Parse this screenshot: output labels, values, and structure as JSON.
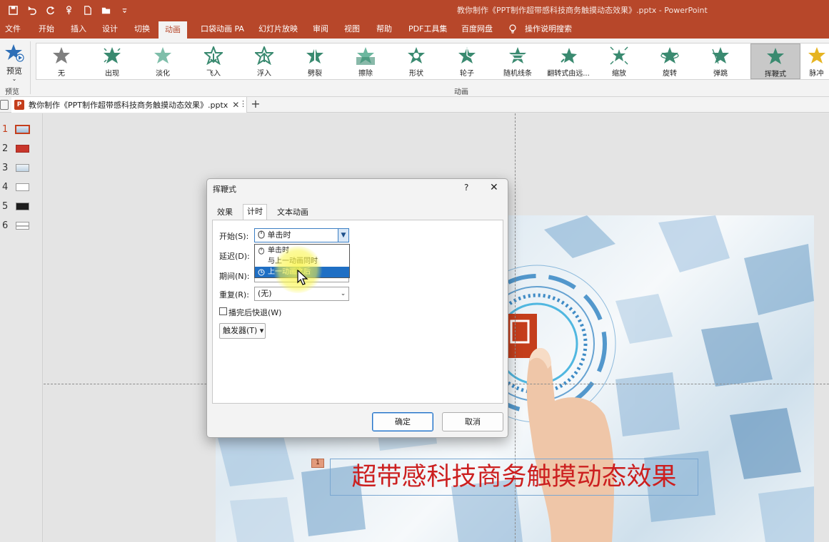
{
  "app": {
    "doc_title": "教你制作《PPT制作超带感科技商务触摸动态效果》.pptx  -  PowerPoint"
  },
  "menu": {
    "items": [
      {
        "label": "文件"
      },
      {
        "label": "开始"
      },
      {
        "label": "插入"
      },
      {
        "label": "设计"
      },
      {
        "label": "切换"
      },
      {
        "label": "动画",
        "active": true
      },
      {
        "label": "口袋动画 PA"
      },
      {
        "label": "幻灯片放映"
      },
      {
        "label": "审阅"
      },
      {
        "label": "视图"
      },
      {
        "label": "帮助"
      },
      {
        "label": "PDF工具集"
      },
      {
        "label": "百度网盘"
      },
      {
        "label": "操作说明搜索"
      }
    ]
  },
  "ribbon": {
    "preview_label": "预览",
    "preview_group_label": "预览",
    "animation_group_label": "动画",
    "animations": [
      {
        "label": "无",
        "icon": "star-gray-icon"
      },
      {
        "label": "出现",
        "icon": "star-green-icon"
      },
      {
        "label": "淡化",
        "icon": "star-green-icon"
      },
      {
        "label": "飞入",
        "icon": "star-green-icon"
      },
      {
        "label": "浮入",
        "icon": "star-green-icon"
      },
      {
        "label": "劈裂",
        "icon": "star-green-icon"
      },
      {
        "label": "擦除",
        "icon": "star-green-icon"
      },
      {
        "label": "形状",
        "icon": "star-green-icon"
      },
      {
        "label": "轮子",
        "icon": "star-green-icon"
      },
      {
        "label": "随机线条",
        "icon": "star-green-icon"
      },
      {
        "label": "翻转式由远...",
        "icon": "star-green-icon"
      },
      {
        "label": "缩放",
        "icon": "star-green-icon"
      },
      {
        "label": "旋转",
        "icon": "star-green-icon"
      },
      {
        "label": "弹跳",
        "icon": "star-green-icon"
      },
      {
        "label": "挥鞭式",
        "icon": "star-green-icon",
        "selected": true
      },
      {
        "label": "脉冲",
        "icon": "star-gold-icon"
      }
    ]
  },
  "doc_tab": {
    "label": "教你制作《PPT制作超带感科技商务触摸动态效果》.pptx",
    "close": "✕",
    "menu": "⋮",
    "add": "+"
  },
  "thumbnails": [
    {
      "num": "1",
      "active": true
    },
    {
      "num": "2"
    },
    {
      "num": "3"
    },
    {
      "num": "4"
    },
    {
      "num": "5"
    },
    {
      "num": "6"
    }
  ],
  "slide": {
    "anim_tag": "1",
    "title": "超带感科技商务触摸动态效果",
    "title_color": "#cc1f1f"
  },
  "dialog": {
    "title": "挥鞭式",
    "help": "?",
    "close": "✕",
    "tabs": [
      {
        "label": "效果"
      },
      {
        "label": "计时",
        "active": true
      },
      {
        "label": "文本动画"
      }
    ],
    "start_label": "开始(S):",
    "start_value": "单击时",
    "delay_label": "延迟(D):",
    "duration_label": "期间(N):",
    "repeat_label": "重复(R):",
    "repeat_value": "(无)",
    "rewind_label": "播完后快退(W)",
    "trigger_label": "触发器(T) ▾",
    "start_options": [
      {
        "label": "单击时"
      },
      {
        "label": "与上一动画同时"
      },
      {
        "label": "上一动画之后",
        "selected": true
      }
    ],
    "ok": "确定",
    "cancel": "取消"
  },
  "colors": {
    "accent": "#b7472a",
    "selection": "#1f6fc4"
  }
}
